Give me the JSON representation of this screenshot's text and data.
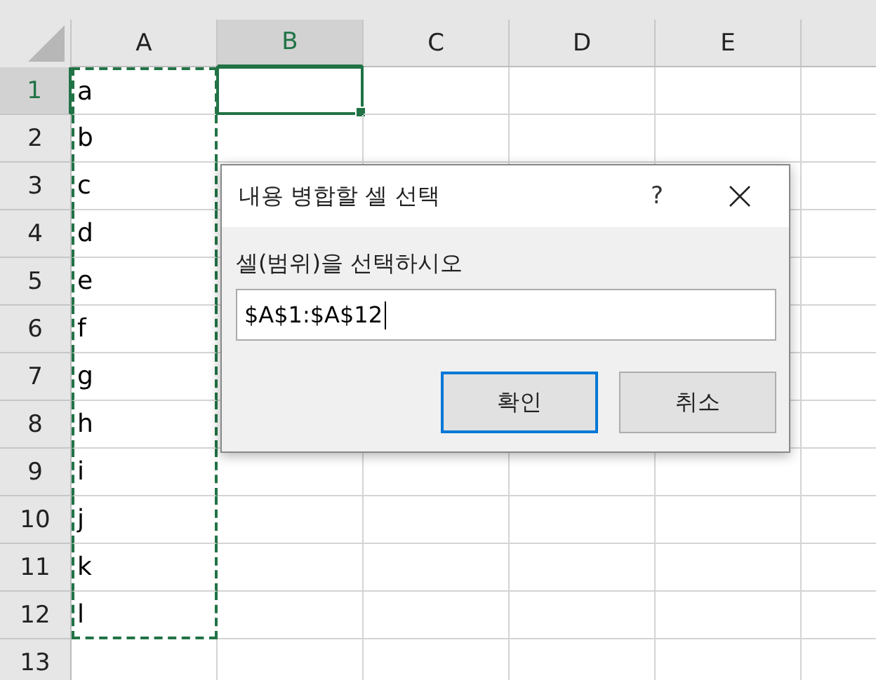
{
  "columns": [
    {
      "label": "A",
      "selected": false
    },
    {
      "label": "B",
      "selected": true
    },
    {
      "label": "C",
      "selected": false
    },
    {
      "label": "D",
      "selected": false
    },
    {
      "label": "E",
      "selected": false
    },
    {
      "selected": false
    }
  ],
  "rows": [
    {
      "number": "1",
      "selected": true,
      "cell_a": "a",
      "in_copy_range": true
    },
    {
      "number": "2",
      "selected": false,
      "cell_a": "b",
      "in_copy_range": true
    },
    {
      "number": "3",
      "selected": false,
      "cell_a": "c",
      "in_copy_range": true
    },
    {
      "number": "4",
      "selected": false,
      "cell_a": "d",
      "in_copy_range": true
    },
    {
      "number": "5",
      "selected": false,
      "cell_a": "e",
      "in_copy_range": true
    },
    {
      "number": "6",
      "selected": false,
      "cell_a": "f",
      "in_copy_range": true
    },
    {
      "number": "7",
      "selected": false,
      "cell_a": "g",
      "in_copy_range": true
    },
    {
      "number": "8",
      "selected": false,
      "cell_a": "h",
      "in_copy_range": true
    },
    {
      "number": "9",
      "selected": false,
      "cell_a": "i",
      "in_copy_range": true
    },
    {
      "number": "10",
      "selected": false,
      "cell_a": "j",
      "in_copy_range": true
    },
    {
      "number": "11",
      "selected": false,
      "cell_a": "k",
      "in_copy_range": true
    },
    {
      "number": "12",
      "selected": false,
      "cell_a": "l",
      "in_copy_range": true
    },
    {
      "number": "13",
      "selected": false,
      "in_copy_range": false
    }
  ],
  "dialog": {
    "title": "내용 병합할 셀 선택",
    "help": "?",
    "prompt": "셀(범위)을 선택하시오",
    "value": "$A$1:$A$12",
    "buttons": [
      {
        "label": "확인",
        "focused": true
      },
      {
        "label": "취소",
        "focused": false
      }
    ]
  }
}
